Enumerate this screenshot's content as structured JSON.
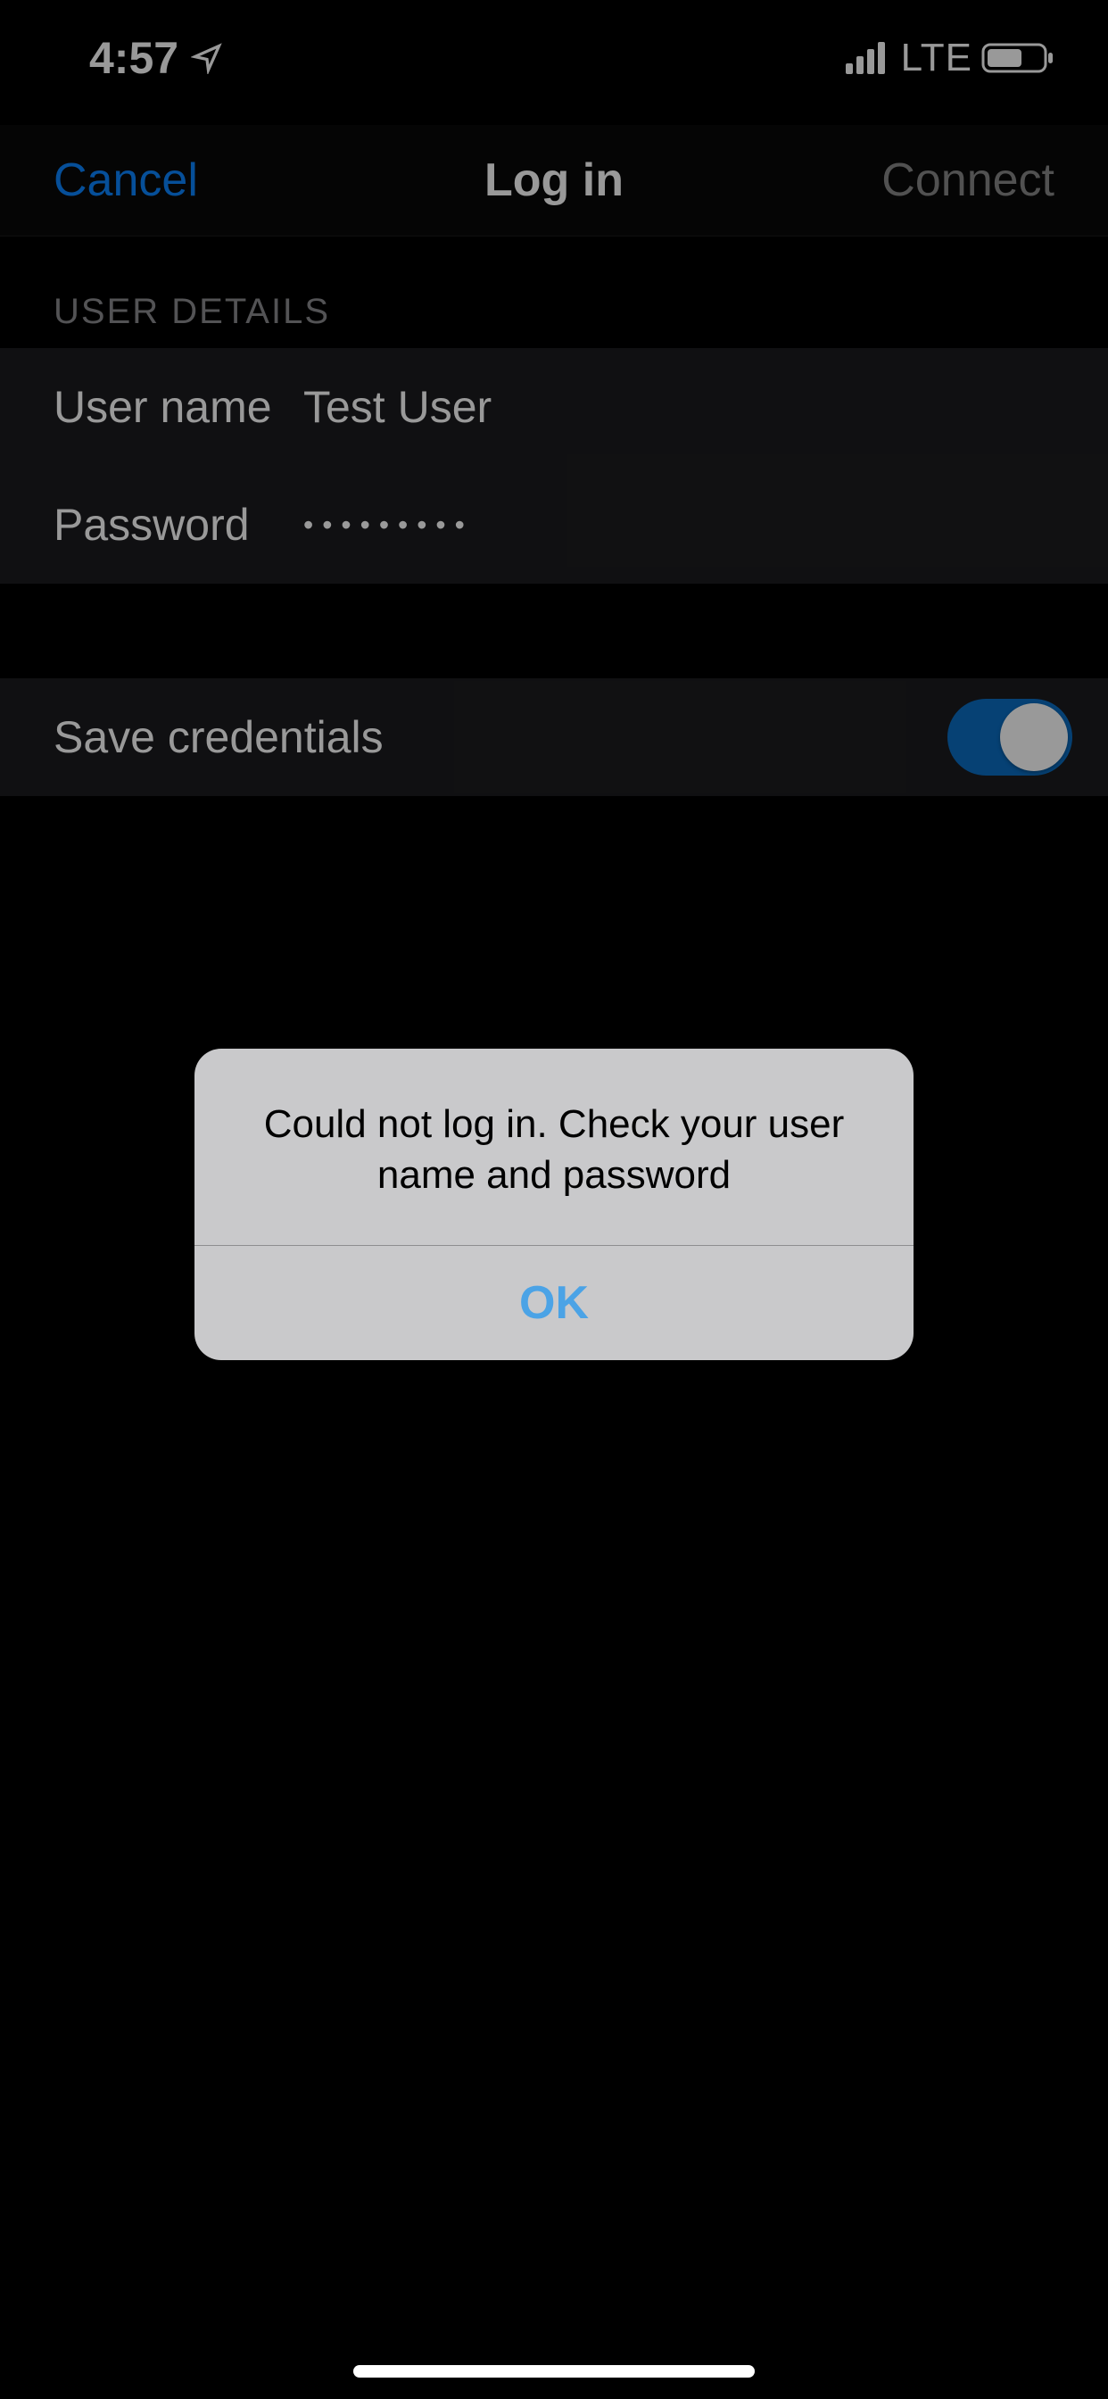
{
  "status_bar": {
    "time": "4:57",
    "network_label": "LTE"
  },
  "nav": {
    "cancel_label": "Cancel",
    "title": "Log in",
    "connect_label": "Connect"
  },
  "section": {
    "header": "USER DETAILS"
  },
  "form": {
    "username_label": "User name",
    "username_value": "Test User",
    "password_label": "Password",
    "password_value": "•••••••••",
    "save_credentials_label": "Save credentials"
  },
  "alert": {
    "message": "Could not log in. Check your user name and password",
    "ok_label": "OK"
  }
}
